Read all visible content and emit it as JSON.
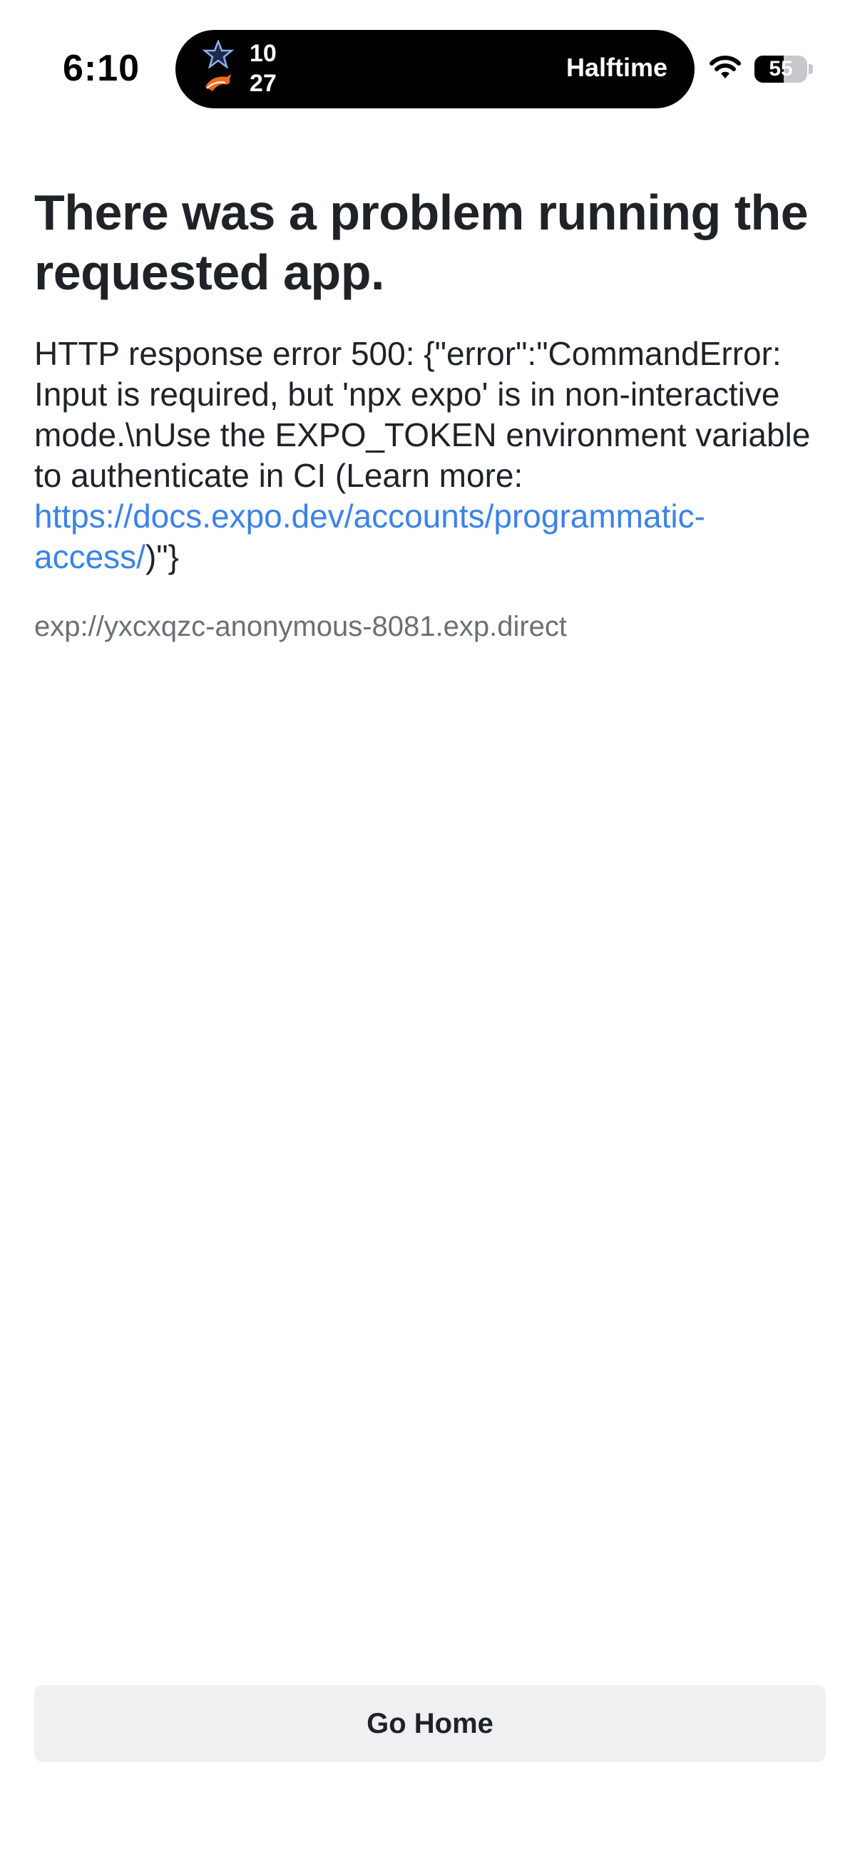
{
  "status_bar": {
    "time": "6:10",
    "live_activity": {
      "team_top_icon": "cowboys-star-logo",
      "team_bottom_icon": "broncos-horse-logo",
      "score_top": "10",
      "score_bottom": "27",
      "game_status": "Halftime"
    },
    "wifi_icon": "wifi-icon",
    "battery_level": "55",
    "battery_fraction": 0.55
  },
  "error_page": {
    "title": "There was a problem running the requested app.",
    "message_prefix": "HTTP response error 500: {\"error\":\"CommandError: Input is required, but 'npx expo' is in non-interactive mode.\\nUse the EXPO_TOKEN environment variable to authenticate in CI (Learn more: ",
    "message_link": "https://docs.expo.dev/accounts/programmatic-access/",
    "message_suffix": ")\"}",
    "app_url": "exp://yxcxqzc-anonymous-8081.exp.direct",
    "home_button_label": "Go Home"
  },
  "colors": {
    "link": "#3b82e8",
    "text": "#1f2328",
    "muted": "#6b6f76",
    "button_bg": "#f0f0f2"
  }
}
